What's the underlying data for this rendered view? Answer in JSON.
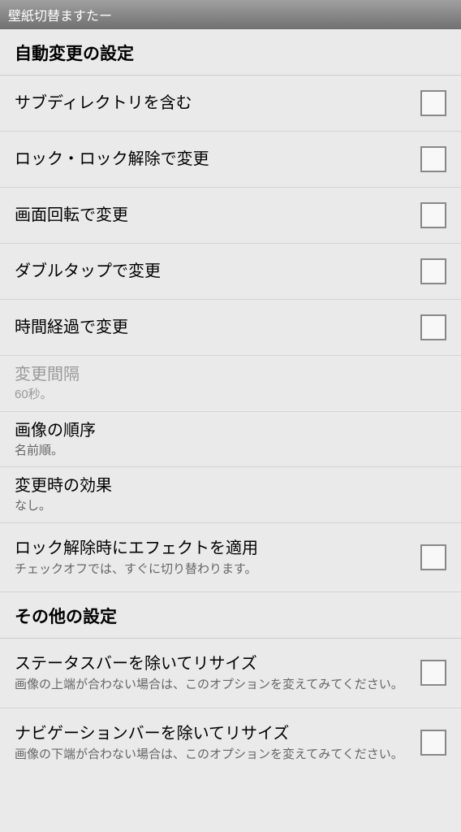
{
  "titlebar": "壁紙切替ますたー",
  "section1": {
    "header": "自動変更の設定",
    "items": [
      {
        "label": "サブディレクトリを含む"
      },
      {
        "label": "ロック・ロック解除で変更"
      },
      {
        "label": "画面回転で変更"
      },
      {
        "label": "ダブルタップで変更"
      },
      {
        "label": "時間経過で変更"
      }
    ],
    "interval": {
      "label": "変更間隔",
      "value": "60秒。"
    },
    "order": {
      "label": "画像の順序",
      "value": "名前順。"
    },
    "effect": {
      "label": "変更時の効果",
      "value": "なし。"
    },
    "unlock_effect": {
      "label": "ロック解除時にエフェクトを適用",
      "sub": "チェックオフでは、すぐに切り替わります。"
    }
  },
  "section2": {
    "header": "その他の設定",
    "items": [
      {
        "label": "ステータスバーを除いてリサイズ",
        "sub": "画像の上端が合わない場合は、このオプションを変えてみてください。"
      },
      {
        "label": "ナビゲーションバーを除いてリサイズ",
        "sub": "画像の下端が合わない場合は、このオプションを変えてみてください。"
      }
    ]
  }
}
